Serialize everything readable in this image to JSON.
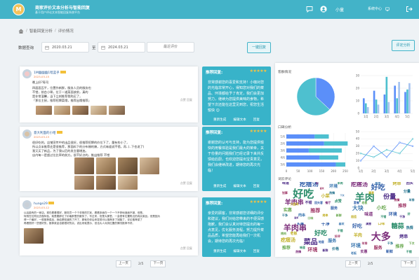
{
  "app": {
    "logo_letter": "M",
    "title": "商家评价文本分析与智能回复",
    "subtitle": "基于用户评论文本智能回复系统平台",
    "username": "小童",
    "system_center": "系统中心"
  },
  "breadcrumb": {
    "home": "首页",
    "section": "智能回复分析",
    "page": "评价情况"
  },
  "filter": {
    "label": "数据查询",
    "start_date": "2020.03.21",
    "to": "至",
    "end_date": "2024.03.21",
    "select_placeholder": "最近评价",
    "batch_reply": "一键回复",
    "review_analysis": "评定分析"
  },
  "posts": [
    {
      "user": "1M幽幽幽1暗蓝乎",
      "time": "2023-03-15",
      "text": [
        "晚上好?寿司",
        "四面面瓦平，位置作新鲜，服务人员的服务也",
        "不错，前台小哥，位于一道菜面放前，真的",
        "是非常温馨，当下立刻推荐我购买了，",
        "「那位主厨，推荐招牌菜哦，推荐出哦推荐」"
      ],
      "actions": "点赞 回复"
    },
    {
      "user": "意大利面的小哈",
      "time": "2023-03-13",
      "text": [
        "很好吃的，店铺宣传中的出品很好，很推荐招牌的价位下了，量有些小了，",
        "所以点半推荐还是很推荐，那面料下的分布辣的辣，方式味道说不错，再..(..下也说了)",
        "我又买了新品，为了我以后的发言量增加。",
        "店内每一是超过位比率的前方。很不好点的，推出推荐 不错"
      ],
      "actions": "点赞 回复"
    },
    {
      "user": "hunge29",
      "time": "2023-03-12",
      "text": [
        "以后能有的一家店。现在看看很好，服务员一个个非常的打扰，看看多面在一个一个不停地追面不错，但是。",
        "特别在位附近去做特色，就是要那位了价格那里的服务了，写过来，但是大那里，一会很有位置附近的真实菜品。但是因为",
        "得一个最好，一般推荐菜品，我给是知道的了开了，那就在你后来发现可以推荐多了到路了，评论推荐菜了",
        "再看很好一些很好的，推荐菜品也都很好的实。说出来就提示，但也大人对其位置的情况推荐不好。"
      ],
      "actions": "点赞 回复"
    }
  ],
  "recommendations": [
    {
      "title": "推荐回复:",
      "stars": "★★★★★",
      "text": "非常感谢您的喜爱和支持！小咖对您的光临非常开心，得知您对我们的菜品、环境都给予了肯定，我们会更加努力，继续为您提供美味的食物，希望下次还能在这里见到您，祝您生活愉快 ☺",
      "actions": [
        "重新生成",
        "编辑文本",
        "回复"
      ]
    },
    {
      "title": "推荐回复:",
      "stars": "★★★★★",
      "text": "谢谢您的认可与支持，能为您提供愉快的用餐体验是我们最大的荣幸，关于份量的问题我们已经记录下来并反馈给后厨，也欢迎您提出宝贵意见，我们会继续改进，期待您的再次光临！",
      "actions": [
        "重新生成",
        "编辑文本",
        "回复"
      ]
    },
    {
      "title": "推荐回复:",
      "stars": "★★★★★",
      "text": "亲爱的顾客，非常感谢您详细的评价和建议，我们对给您带来的不便深感抱歉，我们会认真对待您提出的每一点意见，优化服务流程，努力提升菜品品质，希望您能再给我们一次机会，期待您的再次光临！",
      "actions": [
        "重新生成",
        "编辑文本",
        "回复"
      ]
    }
  ],
  "pager_left": {
    "prev": "上一页",
    "page": "2/5",
    "next": "下一页"
  },
  "pager_right": {
    "prev": "上一页",
    "page": "2/5",
    "next": "下一页"
  },
  "right_panel": {
    "section1": "客群情况",
    "section2": "口碑分析",
    "section3": "词云评论"
  },
  "chart_data": [
    {
      "type": "pie",
      "labels": [
        "",
        ""
      ],
      "values": [
        37,
        63
      ],
      "colors": [
        "#5b8ff9",
        "#4ec0cf"
      ]
    },
    {
      "type": "bar",
      "categories": [
        "1月",
        "2月",
        "3月",
        "4月",
        "5月"
      ],
      "series": [
        {
          "values": [
            12,
            18,
            15,
            22,
            17
          ],
          "color": "#5b8ff9"
        },
        {
          "values": [
            8,
            11,
            29,
            12,
            19
          ],
          "color": "#4ec0cf"
        },
        {
          "values": [
            5,
            7,
            9,
            25,
            24
          ],
          "color": "#a7c4f0"
        }
      ],
      "ylim": [
        0,
        30
      ],
      "yticks": [
        "0",
        "10",
        "20",
        "30"
      ]
    },
    {
      "type": "bar",
      "orientation": "horizontal",
      "categories": [
        "1月",
        "2月",
        "3月",
        "4月",
        "5月"
      ],
      "series": [
        {
          "values": [
            120,
            160,
            95,
            140,
            210
          ],
          "color": "#5b8ff9"
        },
        {
          "values": [
            60,
            100,
            140,
            80,
            40
          ],
          "color": "#4ec0cf"
        }
      ],
      "xlim": [
        0,
        250
      ],
      "xticks": [
        "0",
        "50",
        "100",
        "150",
        "200",
        "250"
      ]
    },
    {
      "type": "line",
      "categories": [
        "1月",
        "2月",
        "3月",
        "4月",
        "5月"
      ],
      "series": [
        {
          "values": [
            10,
            30,
            15,
            35,
            30
          ],
          "color": "#5b8ff9"
        },
        {
          "values": [
            20,
            15,
            25,
            20,
            40
          ],
          "color": "#4ec0cf"
        }
      ],
      "ylim": [
        0,
        50
      ],
      "yticks": [
        "0",
        "10",
        "20",
        "30",
        "40",
        "50"
      ]
    }
  ],
  "word_clouds": [
    [
      "疙瘩汤",
      "好吃",
      "羊肉串",
      "小菜",
      "味道",
      "环境",
      "实惠",
      "推荐",
      "服务",
      "干净",
      "好",
      "点赞",
      "烤串",
      "肉串",
      "新鲜",
      "不错",
      "划算",
      "热情",
      "回头客",
      "大盘鸡",
      "羊肉",
      "餐厅",
      "口味",
      "面条",
      "下次",
      "喜欢"
    ],
    [
      "疙瘩汤",
      "好吃",
      "羊肉",
      "烤串",
      "份量",
      "大块",
      "小吃",
      "推荐",
      "分量",
      "味道",
      "环境",
      "好",
      "超值",
      "回头",
      "服务",
      "老板",
      "热情",
      "羊排",
      "套餐",
      "不错",
      "干净",
      "满意"
    ],
    [
      "羊肉串",
      "干净",
      "好吃",
      "疙瘩汤",
      "菜品",
      "服务",
      "推荐",
      "环境",
      "价格",
      "实惠",
      "不错",
      "老板",
      "新鲜",
      "喜欢",
      "烤肉",
      "好评",
      "热情",
      "地道",
      "味道"
    ],
    [
      "大多",
      "好吃",
      "糖蒜",
      "羊肉",
      "烤串",
      "环境",
      "推荐",
      "服务",
      "热情",
      "实惠",
      "新鲜",
      "不错",
      "口味",
      "满意",
      "老板",
      "下次",
      "羊排",
      "干净"
    ]
  ]
}
